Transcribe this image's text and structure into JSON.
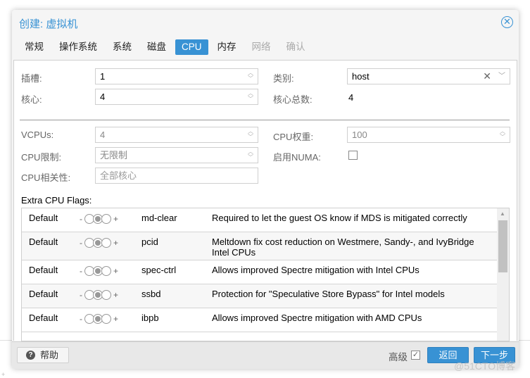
{
  "dialog": {
    "title": "创建: 虚拟机",
    "close_icon": "close-circle-icon"
  },
  "tabs": [
    {
      "label": "常规",
      "state": "normal"
    },
    {
      "label": "操作系统",
      "state": "normal"
    },
    {
      "label": "系统",
      "state": "normal"
    },
    {
      "label": "磁盘",
      "state": "normal"
    },
    {
      "label": "CPU",
      "state": "active"
    },
    {
      "label": "内存",
      "state": "normal"
    },
    {
      "label": "网络",
      "state": "disabled"
    },
    {
      "label": "确认",
      "state": "disabled"
    }
  ],
  "form": {
    "sockets": {
      "label": "插槽:",
      "value": "1"
    },
    "cores": {
      "label": "核心:",
      "value": "4"
    },
    "type": {
      "label": "类别:",
      "value": "host"
    },
    "total_cores": {
      "label": "核心总数:",
      "value": "4"
    },
    "vcpus": {
      "label": "VCPUs:",
      "value": "4"
    },
    "cpu_limit": {
      "label": "CPU限制:",
      "value": "无限制"
    },
    "cpu_affinity": {
      "label": "CPU相关性:",
      "placeholder": "全部核心"
    },
    "cpu_weight": {
      "label": "CPU权重:",
      "value": "100"
    },
    "numa": {
      "label": "启用NUMA:",
      "checked": false
    }
  },
  "flags": {
    "label": "Extra CPU Flags:",
    "minus": "-",
    "plus": "+",
    "rows": [
      {
        "state": "Default",
        "name": "md-clear",
        "desc": "Required to let the guest OS know if MDS is mitigated correctly"
      },
      {
        "state": "Default",
        "name": "pcid",
        "desc": "Meltdown fix cost reduction on Westmere, Sandy-, and IvyBridge Intel CPUs"
      },
      {
        "state": "Default",
        "name": "spec-ctrl",
        "desc": "Allows improved Spectre mitigation with Intel CPUs"
      },
      {
        "state": "Default",
        "name": "ssbd",
        "desc": "Protection for \"Speculative Store Bypass\" for Intel models"
      },
      {
        "state": "Default",
        "name": "ibpb",
        "desc": "Allows improved Spectre mitigation with AMD CPUs"
      }
    ]
  },
  "footer": {
    "help": "帮助",
    "advanced": "高级",
    "advanced_checked": true,
    "back": "返回",
    "next": "下一步"
  },
  "watermark": "@51CTO博客",
  "colors": {
    "accent": "#3892d4"
  }
}
